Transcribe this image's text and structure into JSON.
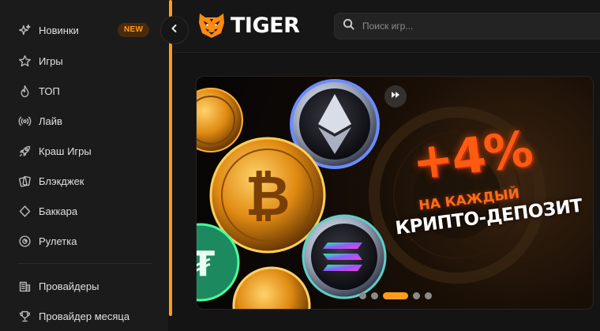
{
  "sidebar": {
    "items": [
      {
        "label": "Новинки",
        "icon": "sparkle-icon",
        "badge": "NEW"
      },
      {
        "label": "Игры",
        "icon": "star-icon"
      },
      {
        "label": "ТОП",
        "icon": "flame-icon"
      },
      {
        "label": "Лайв",
        "icon": "live-broadcast-icon"
      },
      {
        "label": "Краш Игры",
        "icon": "rocket-icon"
      },
      {
        "label": "Блэкджек",
        "icon": "cards-icon"
      },
      {
        "label": "Баккара",
        "icon": "diamond-icon"
      },
      {
        "label": "Рулетка",
        "icon": "roulette-icon"
      },
      {
        "label": "Провайдеры",
        "icon": "building-icon"
      },
      {
        "label": "Провайдер месяца",
        "icon": "trophy-icon"
      }
    ]
  },
  "header": {
    "logo_text": "TIGER",
    "search_placeholder": "Поиск игр..."
  },
  "banner": {
    "headline": "+4%",
    "line1": "НА КАЖДЫЙ",
    "line2": "КРИПТО-ДЕПОЗИТ",
    "slide_count": 5,
    "active_slide": 3
  },
  "colors": {
    "accent": "#ff9c1a",
    "promo_orange": "#ff5a12",
    "badge_bg": "#4a2a0c",
    "badge_text": "#ff9a1f"
  }
}
